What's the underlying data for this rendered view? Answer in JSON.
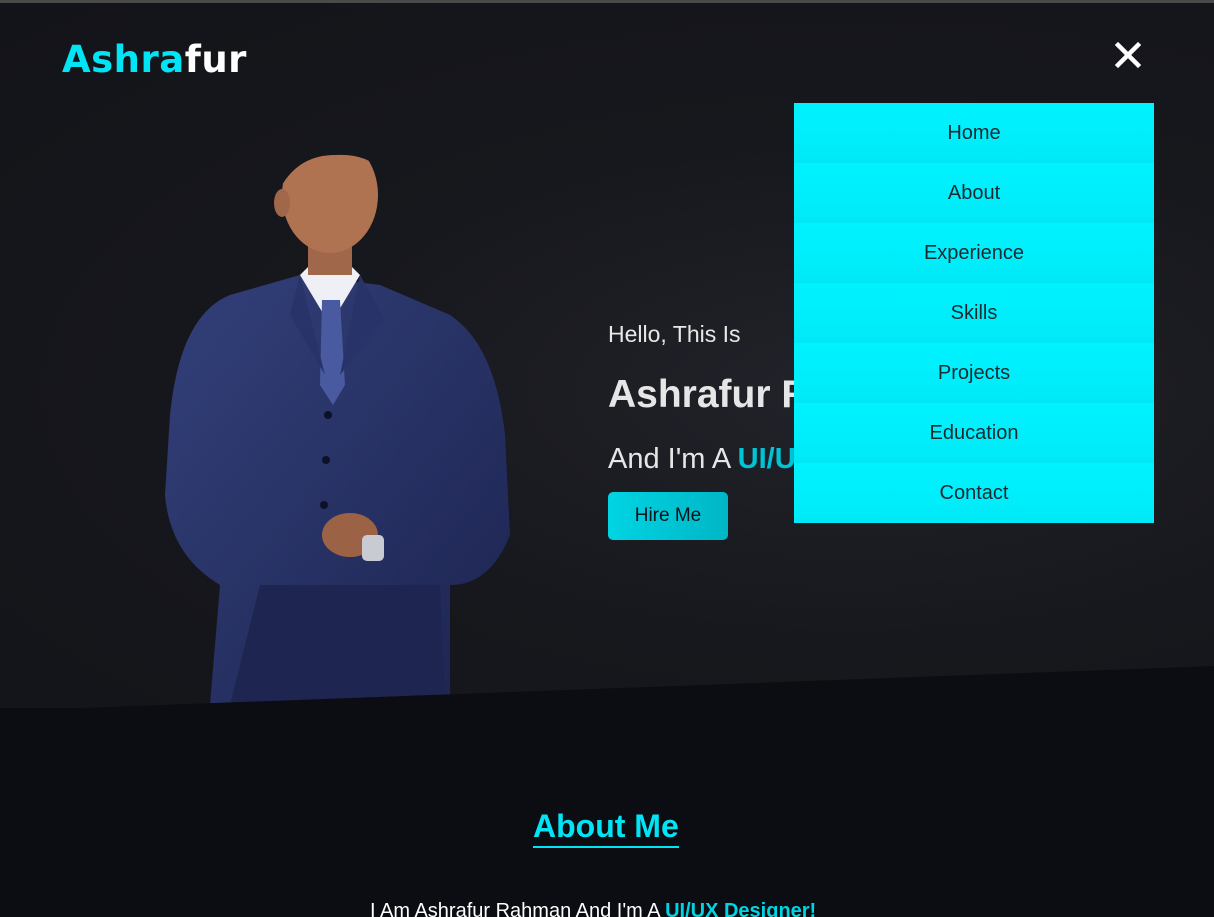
{
  "brand": {
    "logo_part1": "Ashra",
    "logo_part2": "fur"
  },
  "hero": {
    "greeting": "Hello, This Is",
    "name": "Ashrafur R",
    "role_prefix": "And I'm A ",
    "role_highlight": "UI/U",
    "hire_button": "Hire Me"
  },
  "menu": {
    "items": [
      {
        "label": "Home"
      },
      {
        "label": "About"
      },
      {
        "label": "Experience"
      },
      {
        "label": "Skills"
      },
      {
        "label": "Projects"
      },
      {
        "label": "Education"
      },
      {
        "label": "Contact"
      }
    ]
  },
  "about": {
    "title": "About Me",
    "text_prefix": "I Am Ashrafur Rahman And I'm A ",
    "text_highlight": "UI/UX Designer!"
  },
  "icons": {
    "close": "close-icon"
  },
  "colors": {
    "accent": "#00e5f5",
    "menu_bg": "#00f0fd",
    "background": "#0b0d12"
  }
}
